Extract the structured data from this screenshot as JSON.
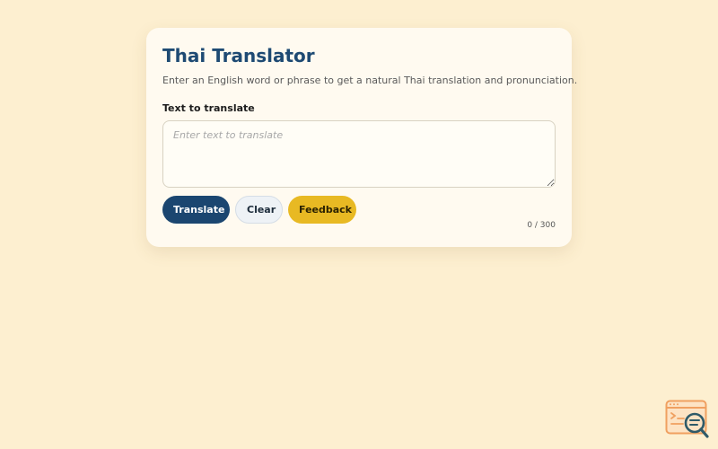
{
  "app": {
    "title": "Thai Translator",
    "subtitle": "Enter an English word or phrase to get a natural Thai translation and pronunciation."
  },
  "input": {
    "label": "Text to translate",
    "placeholder": "Enter text to translate",
    "value": ""
  },
  "actions": {
    "translate_label": "Translate",
    "clear_label": "Clear",
    "feedback_label": "Feedback"
  },
  "counter": {
    "text": "0 / 300"
  },
  "colors": {
    "background": "#fdefd0",
    "card": "#fffaf0",
    "primary": "#1b4670",
    "accent": "#e8b923",
    "logo": "#f0a060"
  },
  "icons": {
    "corner_logo": "browser-search-icon"
  }
}
